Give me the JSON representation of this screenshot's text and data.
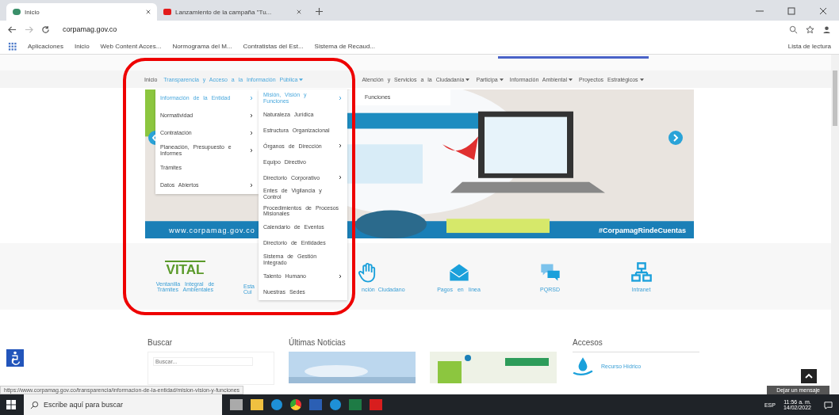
{
  "browser": {
    "tabs": [
      {
        "title": "Inicio",
        "selected": true
      },
      {
        "title": "Lanzamiento de la campaña \"Tu...",
        "selected": false
      }
    ],
    "url": "corpamag.gov.co",
    "bookmarks": [
      "Aplicaciones",
      "Inicio",
      "Web Content Acces...",
      "Normograma del M...",
      "Contratistas del Est...",
      "Sistema de Recaud..."
    ],
    "reading_list": "Lista de lectura"
  },
  "nav": [
    {
      "label": "Inicio",
      "has_menu": false,
      "selected": false
    },
    {
      "label": "Transparencia y Acceso a la Información Pública",
      "has_menu": true,
      "selected": true
    },
    {
      "label": "Atención y Servicios a la Ciudadanía",
      "has_menu": true,
      "selected": false
    },
    {
      "label": "Participa",
      "has_menu": true,
      "selected": false
    },
    {
      "label": "Información Ambiental",
      "has_menu": true,
      "selected": false
    },
    {
      "label": "Proyectos Estratégicos",
      "has_menu": true,
      "selected": false
    }
  ],
  "menu": {
    "items": [
      {
        "label": "Información de la Entidad",
        "submenu": true,
        "selected": true
      },
      {
        "label": "Normatividad",
        "submenu": true,
        "selected": false
      },
      {
        "label": "Contratación",
        "submenu": true,
        "selected": false
      },
      {
        "label": "Planeación, Presupuesto e Informes",
        "submenu": true,
        "selected": false
      },
      {
        "label": "Trámites",
        "submenu": false,
        "selected": false
      },
      {
        "label": "Datos Abiertos",
        "submenu": true,
        "selected": false
      }
    ]
  },
  "submenu": {
    "items": [
      {
        "label": "Misión, Visión y Funciones",
        "submenu": true,
        "selected": true
      },
      {
        "label": "Naturaleza Jurídica",
        "submenu": false,
        "selected": false
      },
      {
        "label": "Estructura Organizacional",
        "submenu": false,
        "selected": false
      },
      {
        "label": "Órganos de Dirección",
        "submenu": true,
        "selected": false
      },
      {
        "label": "Equipo Directivo",
        "submenu": false,
        "selected": false
      },
      {
        "label": "Directorio Corporativo",
        "submenu": true,
        "selected": false
      },
      {
        "label": "Entes de Vigilancia y Control",
        "submenu": false,
        "selected": false
      },
      {
        "label": "Procedimientos de Procesos Misionales",
        "submenu": false,
        "selected": false
      },
      {
        "label": "Calendario de Eventos",
        "submenu": false,
        "selected": false
      },
      {
        "label": "Directorio de Entidades",
        "submenu": false,
        "selected": false
      },
      {
        "label": "Sistema de Gestión Integrado",
        "submenu": false,
        "selected": false
      },
      {
        "label": "Talento Humano",
        "submenu": true,
        "selected": false
      },
      {
        "label": "Nuestras Sedes",
        "submenu": false,
        "selected": false
      }
    ]
  },
  "flyout": {
    "items": [
      "Funciones"
    ]
  },
  "banner": {
    "site_url": "www.corpamag.gov.co",
    "hashtag": "#CorpamagRindeCuentas"
  },
  "quick_links": [
    {
      "kind": "vital",
      "logo": "VITAL",
      "label": "Ventanilla Integral de Trámites Ambientales"
    },
    {
      "kind": "cut",
      "label": "Esta Cui"
    },
    {
      "kind": "hand",
      "label": "nción Ciudadano"
    },
    {
      "kind": "mail",
      "label": "Pagos en línea"
    },
    {
      "kind": "chat",
      "label": "PQRSD"
    },
    {
      "kind": "network",
      "label": "Intranet"
    }
  ],
  "sections": {
    "search": {
      "title": "Buscar",
      "placeholder": "Buscar..."
    },
    "news": {
      "title": "Últimas Noticias"
    },
    "access": {
      "title": "Accesos",
      "items": [
        "Recurso Hídrico"
      ]
    }
  },
  "status_url": "https://www.corpamag.gov.co/transparencia/informacion-de-la-entidad/mision-vision-y-funciones",
  "chat": "Dejar un mensaje",
  "taskbar": {
    "search_placeholder": "Escribe aquí para buscar",
    "language": "ESP",
    "time": "11:56 a. m.",
    "date": "14/02/2022"
  }
}
